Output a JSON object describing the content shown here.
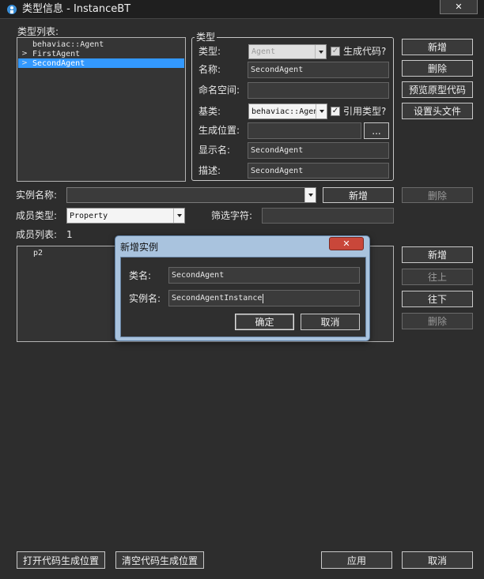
{
  "window": {
    "title": "类型信息 - InstanceBT",
    "close_label": "✕"
  },
  "type_list": {
    "label": "类型列表:",
    "items": [
      {
        "marker": "",
        "text": "behaviac::Agent"
      },
      {
        "marker": ">",
        "text": "FirstAgent"
      },
      {
        "marker": ">",
        "text": "SecondAgent"
      }
    ]
  },
  "type_group": {
    "legend": "类型",
    "type_label": "类型:",
    "type_value": "Agent",
    "gen_code_label": "生成代码?",
    "name_label": "名称:",
    "name_value": "SecondAgent",
    "namespace_label": "命名空间:",
    "namespace_value": "",
    "base_label": "基类:",
    "base_value": "behaviac::Agent",
    "ref_type_label": "引用类型?",
    "gen_location_label": "生成位置:",
    "gen_location_value": "",
    "browse_label": "...",
    "display_name_label": "显示名:",
    "display_name_value": "SecondAgent",
    "desc_label": "描述:",
    "desc_value": "SecondAgent"
  },
  "right_buttons": {
    "add": "新增",
    "delete": "删除",
    "preview": "预览原型代码",
    "set_header": "设置头文件"
  },
  "instance": {
    "label": "实例名称:",
    "value": "",
    "add": "新增",
    "delete": "删除"
  },
  "member": {
    "type_label": "成员类型:",
    "type_value": "Property",
    "filter_label": "筛选字符:",
    "filter_value": "",
    "list_label": "成员列表:",
    "count": "1",
    "items": [
      "p2"
    ]
  },
  "member_buttons": {
    "add": "新增",
    "up": "往上",
    "down": "往下",
    "delete": "删除"
  },
  "dialog": {
    "title": "新增实例",
    "close_label": "✕",
    "class_label": "类名:",
    "class_value": "SecondAgent",
    "instance_label": "实例名:",
    "instance_value": "SecondAgentInstance",
    "ok": "确定",
    "cancel": "取消"
  },
  "footer": {
    "open_location": "打开代码生成位置",
    "clear_location": "清空代码生成位置",
    "apply": "应用",
    "cancel": "取消"
  },
  "colors": {
    "selection": "#3399ff",
    "close_button": "#c9473a",
    "background": "#2d2d2d"
  }
}
